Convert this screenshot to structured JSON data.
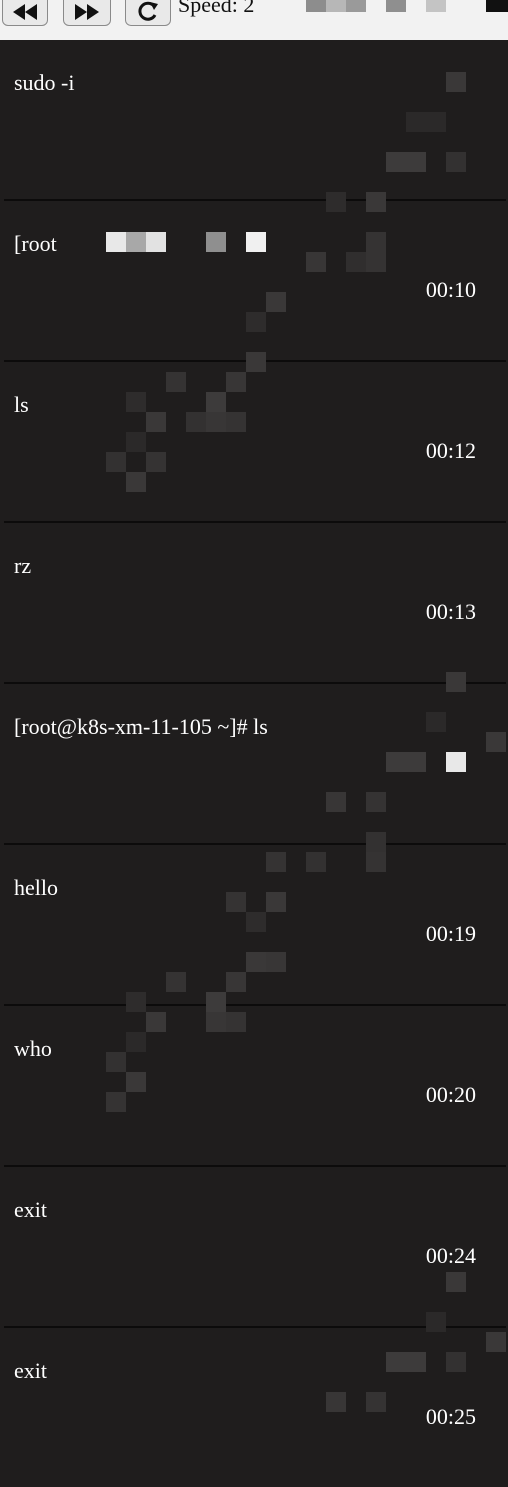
{
  "toolbar": {
    "rewind_icon": "rewind-icon",
    "fast_forward_icon": "fast-forward-icon",
    "reload_icon": "reload-icon",
    "speed_label": "Speed: 2"
  },
  "entries": [
    {
      "command": "sudo -i",
      "time": ""
    },
    {
      "command": "[root",
      "time": "00:10"
    },
    {
      "command": "ls",
      "time": "00:12"
    },
    {
      "command": "rz",
      "time": "00:13"
    },
    {
      "command": "[root@k8s-xm-11-105 ~]# ls",
      "time": ""
    },
    {
      "command": "hello",
      "time": "00:19"
    },
    {
      "command": "who",
      "time": "00:20"
    },
    {
      "command": "exit",
      "time": "00:24"
    },
    {
      "command": "exit",
      "time": "00:25"
    }
  ],
  "colors": {
    "background": "#1f1d1d",
    "toolbar": "#f2f2f2",
    "divider": "#0c0b0b",
    "text": "#ffffff"
  }
}
